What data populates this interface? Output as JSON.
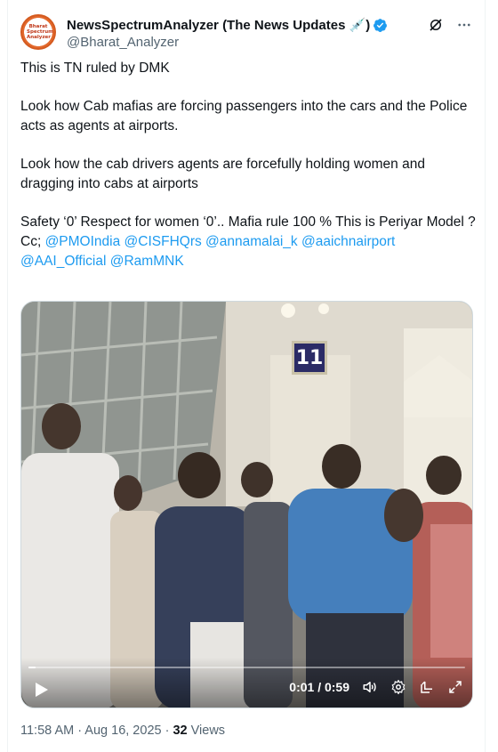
{
  "author": {
    "display_name": "NewsSpectrumAnalyzer (The News Updates 💉)",
    "handle": "@Bharat_Analyzer",
    "avatar_text": "Bharat Spectrum Analyzer",
    "verified_color": "#1d9bf0"
  },
  "tweet": {
    "line1": "This is TN ruled by DMK",
    "line2": "Look how Cab mafias are forcing passengers into the cars and the Police acts as agents at airports.",
    "line3": "Look how the cab drivers agents are forcefully holding women and dragging into cabs at airports",
    "line4": "Safety ‘0’ Respect for women ‘0’.. Mafia rule 100 % This is Periyar Model ?",
    "cc_prefix": "Cc; ",
    "mentions": [
      "@PMOIndia",
      "@CISFHQrs",
      "@annamalai_k",
      "@aaichnairport",
      "@AAI_Official",
      "@RamMNK"
    ]
  },
  "video": {
    "current_time": "0:01",
    "duration": "0:59",
    "time_display": "0:01 / 0:59",
    "progress_fraction": 0.017,
    "sign_number": "11"
  },
  "meta": {
    "time": "11:58 AM",
    "date": "Aug 16, 2025",
    "separator": " · ",
    "views_count": "32",
    "views_label": " Views"
  },
  "icons": {
    "grok": "grok-icon",
    "more": "more-icon",
    "play": "play-icon",
    "volume": "volume-icon",
    "settings": "gear-icon",
    "popout": "popout-icon",
    "fullscreen": "fullscreen-icon"
  },
  "colors": {
    "link": "#1d9bf0",
    "secondary_text": "#536471",
    "primary_text": "#0f1419"
  }
}
